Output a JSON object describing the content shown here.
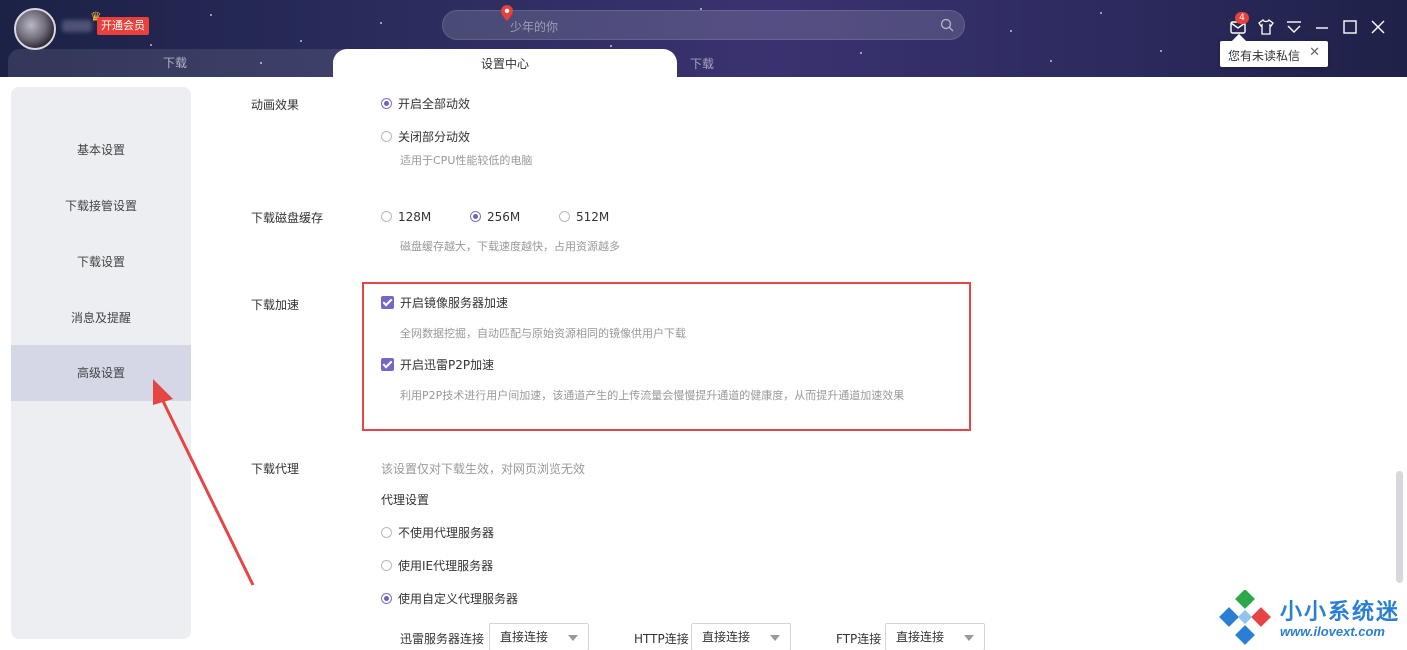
{
  "titlebar": {
    "vip_label": "开通会员",
    "search_placeholder": "少年的你",
    "message_badge": "4",
    "tooltip_text": "您有未读私信",
    "tooltip_close": "✕"
  },
  "tabs": {
    "download": "下载",
    "settings": "设置中心",
    "third": "下载"
  },
  "sidebar": {
    "items": [
      {
        "label": "基本设置",
        "active": false
      },
      {
        "label": "下载接管设置",
        "active": false
      },
      {
        "label": "下载设置",
        "active": false
      },
      {
        "label": "消息及提醒",
        "active": false
      },
      {
        "label": "高级设置",
        "active": true
      }
    ]
  },
  "animation": {
    "label": "动画效果",
    "options": [
      "开启全部动效",
      "关闭部分动效"
    ],
    "selected": 0,
    "hint": "适用于CPU性能较低的电脑"
  },
  "disk_cache": {
    "label": "下载磁盘缓存",
    "options": [
      "128M",
      "256M",
      "512M"
    ],
    "selected": 1,
    "hint": "磁盘缓存越大，下载速度越快，占用资源越多"
  },
  "acceleration": {
    "label": "下载加速",
    "mirror_label": "开启镜像服务器加速",
    "mirror_checked": true,
    "mirror_hint": "全网数据挖掘，自动匹配与原始资源相同的镜像供用户下载",
    "p2p_label": "开启迅雷P2P加速",
    "p2p_checked": true,
    "p2p_hint": "利用P2P技术进行用户间加速，该通道产生的上传流量会慢慢提升通道的健康度，从而提升通道加速效果"
  },
  "proxy": {
    "label": "下载代理",
    "note": "该设置仅对下载生效，对网页浏览无效",
    "subheading": "代理设置",
    "options": [
      "不使用代理服务器",
      "使用IE代理服务器",
      "使用自定义代理服务器"
    ],
    "selected": 2,
    "connections": [
      {
        "label": "迅雷服务器连接",
        "value": "直接连接"
      },
      {
        "label": "HTTP连接",
        "value": "直接连接"
      },
      {
        "label": "FTP连接",
        "value": "直接连接"
      }
    ]
  },
  "watermark": {
    "title": "小小系统迷",
    "url": "www.ilovext.com"
  },
  "colors": {
    "accent": "#7468c4",
    "highlight_box": "#e64545",
    "vip": "#e8403a",
    "titlebar": "#2b2d5e"
  }
}
